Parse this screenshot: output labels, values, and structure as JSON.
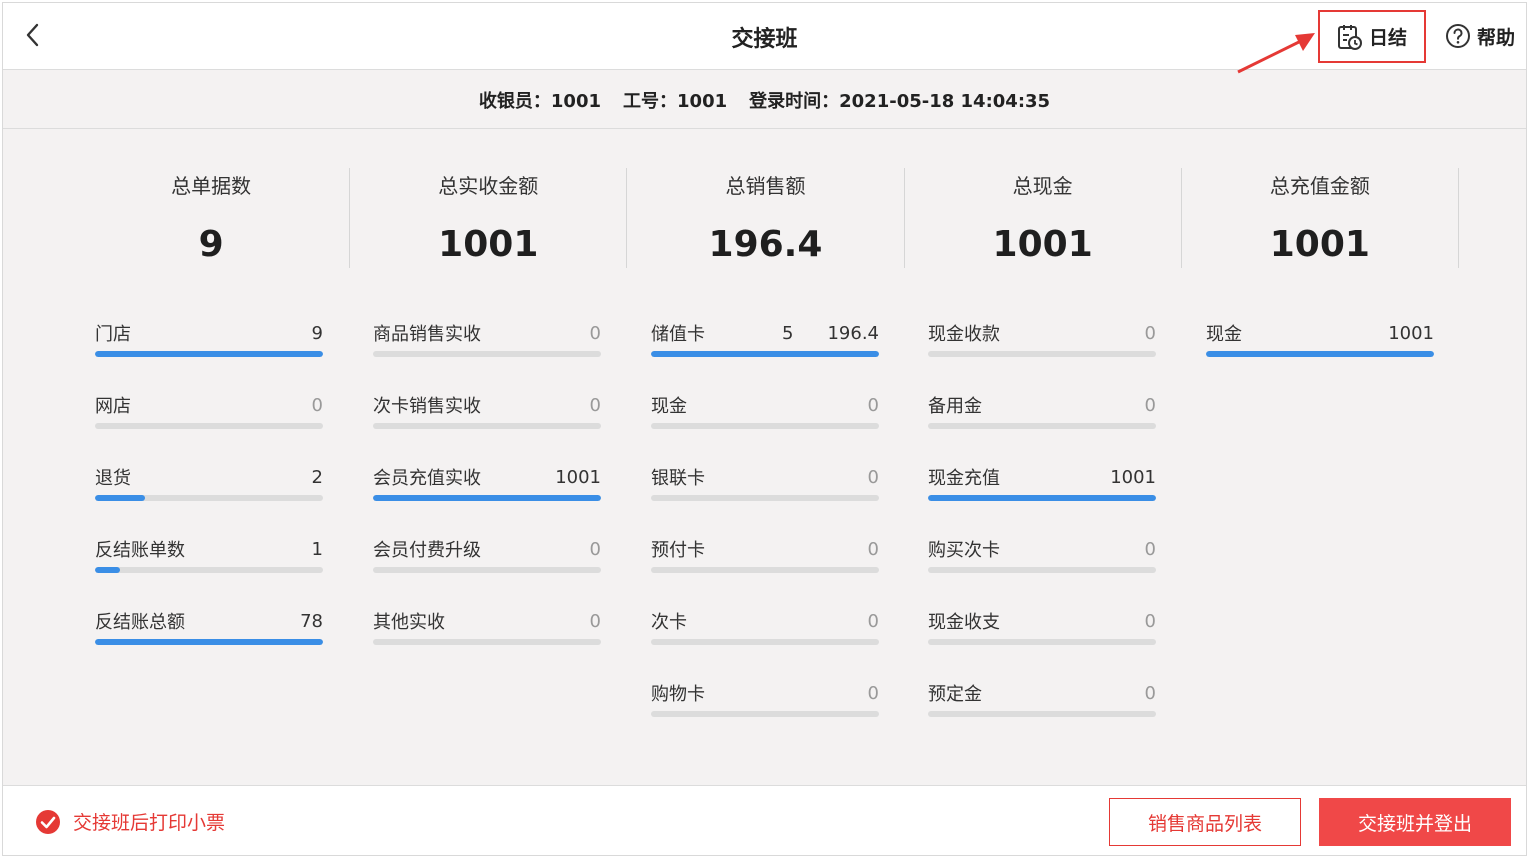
{
  "header": {
    "title": "交接班",
    "daily_label": "日结",
    "help_label": "帮助"
  },
  "info": {
    "cashier": "收银员：1001",
    "staff_no": "工号：1001",
    "login_time": "登录时间：2021-05-18 14:04:35"
  },
  "summary": [
    {
      "label": "总单据数",
      "value": "9"
    },
    {
      "label": "总实收金额",
      "value": "1001"
    },
    {
      "label": "总销售额",
      "value": "196.4"
    },
    {
      "label": "总现金",
      "value": "1001"
    },
    {
      "label": "总充值金额",
      "value": "1001"
    }
  ],
  "columns": [
    {
      "items": [
        {
          "label": "门店",
          "value": "9",
          "fill": 1.0
        },
        {
          "label": "网店",
          "value": "0",
          "fill": 0
        },
        {
          "label": "退货",
          "value": "2",
          "fill": 0.22
        },
        {
          "label": "反结账单数",
          "value": "1",
          "fill": 0.11
        },
        {
          "label": "反结账总额",
          "value": "78",
          "fill": 1.0
        }
      ]
    },
    {
      "items": [
        {
          "label": "商品销售实收",
          "value": "0",
          "fill": 0
        },
        {
          "label": "次卡销售实收",
          "value": "0",
          "fill": 0
        },
        {
          "label": "会员充值实收",
          "value": "1001",
          "fill": 1.0
        },
        {
          "label": "会员付费升级",
          "value": "0",
          "fill": 0
        },
        {
          "label": "其他实收",
          "value": "0",
          "fill": 0
        }
      ]
    },
    {
      "items": [
        {
          "label": "储值卡",
          "count": "5",
          "value": "196.4",
          "fill": 1.0
        },
        {
          "label": "现金",
          "value": "0",
          "fill": 0
        },
        {
          "label": "银联卡",
          "value": "0",
          "fill": 0
        },
        {
          "label": "预付卡",
          "value": "0",
          "fill": 0
        },
        {
          "label": "次卡",
          "value": "0",
          "fill": 0
        },
        {
          "label": "购物卡",
          "value": "0",
          "fill": 0
        }
      ]
    },
    {
      "items": [
        {
          "label": "现金收款",
          "value": "0",
          "fill": 0
        },
        {
          "label": "备用金",
          "value": "0",
          "fill": 0
        },
        {
          "label": "现金充值",
          "value": "1001",
          "fill": 1.0
        },
        {
          "label": "购买次卡",
          "value": "0",
          "fill": 0
        },
        {
          "label": "现金收支",
          "value": "0",
          "fill": 0
        },
        {
          "label": "预定金",
          "value": "0",
          "fill": 0
        }
      ]
    },
    {
      "items": [
        {
          "label": "现金",
          "value": "1001",
          "fill": 1.0
        }
      ]
    }
  ],
  "footer": {
    "print_label": "交接班后打印小票",
    "sales_list_label": "销售商品列表",
    "handover_logout_label": "交接班并登出"
  },
  "colors": {
    "accent": "#e53935",
    "bar_fill": "#3a8ee6",
    "bar_track": "#dcdcdc"
  }
}
